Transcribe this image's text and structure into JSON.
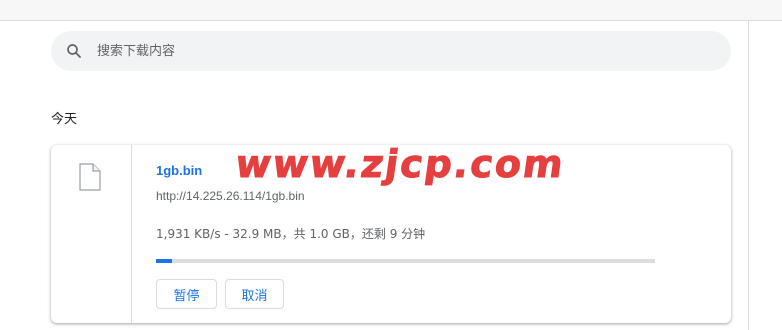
{
  "search": {
    "placeholder": "搜索下载内容"
  },
  "date_group": "今天",
  "download": {
    "file_name": "1gb.bin",
    "url": "http://14.225.26.114/1gb.bin",
    "status": "1,931 KB/s - 32.9 MB，共 1.0 GB，还剩 9 分钟",
    "progress_fraction": 0.032,
    "pause_label": "暂停",
    "cancel_label": "取消"
  },
  "watermark": "www.zjcp.com",
  "colors": {
    "accent": "#1a73e8",
    "watermark": "#e32b2b"
  },
  "icons": {
    "search": "search-icon",
    "file": "file-icon"
  }
}
